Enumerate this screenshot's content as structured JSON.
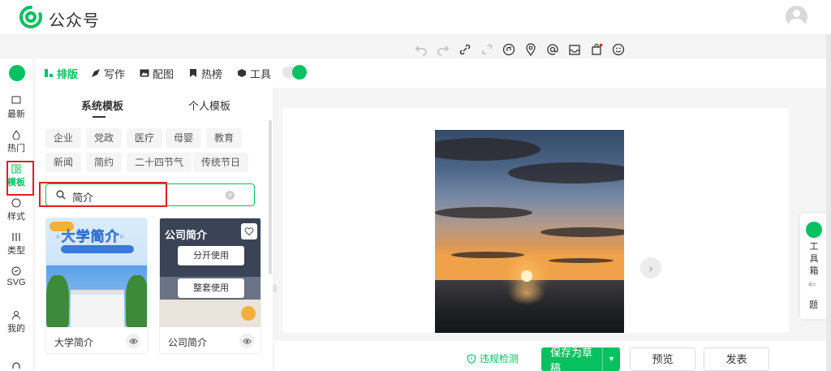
{
  "app": {
    "brand": "公众号"
  },
  "toolbar": {
    "icons": [
      "undo-icon",
      "redo-icon",
      "link-icon",
      "unlink-icon",
      "music-icon",
      "location-icon",
      "mention-icon",
      "inbox-icon",
      "shop-icon",
      "emoji-icon"
    ]
  },
  "rail": {
    "items": [
      {
        "label": "最新",
        "icon": "chat-icon"
      },
      {
        "label": "热门",
        "icon": "fire-icon"
      },
      {
        "label": "模板",
        "icon": "template-icon",
        "active": true
      },
      {
        "label": "样式",
        "icon": "palette-icon"
      },
      {
        "label": "类型",
        "icon": "columns-icon"
      },
      {
        "label": "SVG",
        "icon": "svg-icon"
      },
      {
        "label": "我的",
        "icon": "user-icon"
      }
    ]
  },
  "tabs": [
    {
      "label": "排版",
      "active": true
    },
    {
      "label": "写作"
    },
    {
      "label": "配图"
    },
    {
      "label": "热榜"
    },
    {
      "label": "工具"
    }
  ],
  "panel": {
    "subtabs": [
      "系统模板",
      "个人模板"
    ],
    "chips": [
      "企业",
      "党政",
      "医疗",
      "母婴",
      "教育",
      "新闻",
      "简约",
      "二十四节气",
      "传统节日"
    ],
    "search_value": "简介",
    "cards": [
      {
        "caption": "大学简介",
        "thumb_title": "·大学简介·"
      },
      {
        "caption": "公司简介",
        "thumb_title": "公司简介",
        "hover_actions": [
          "分开使用",
          "整套使用"
        ]
      }
    ]
  },
  "toolbox": {
    "label": "工具箱",
    "extra": "题"
  },
  "actions": {
    "check": "违规检测",
    "save": "保存为草稿",
    "preview": "预览",
    "publish": "发表"
  },
  "colors": {
    "accent": "#07c160",
    "highlight": "#e02020"
  }
}
